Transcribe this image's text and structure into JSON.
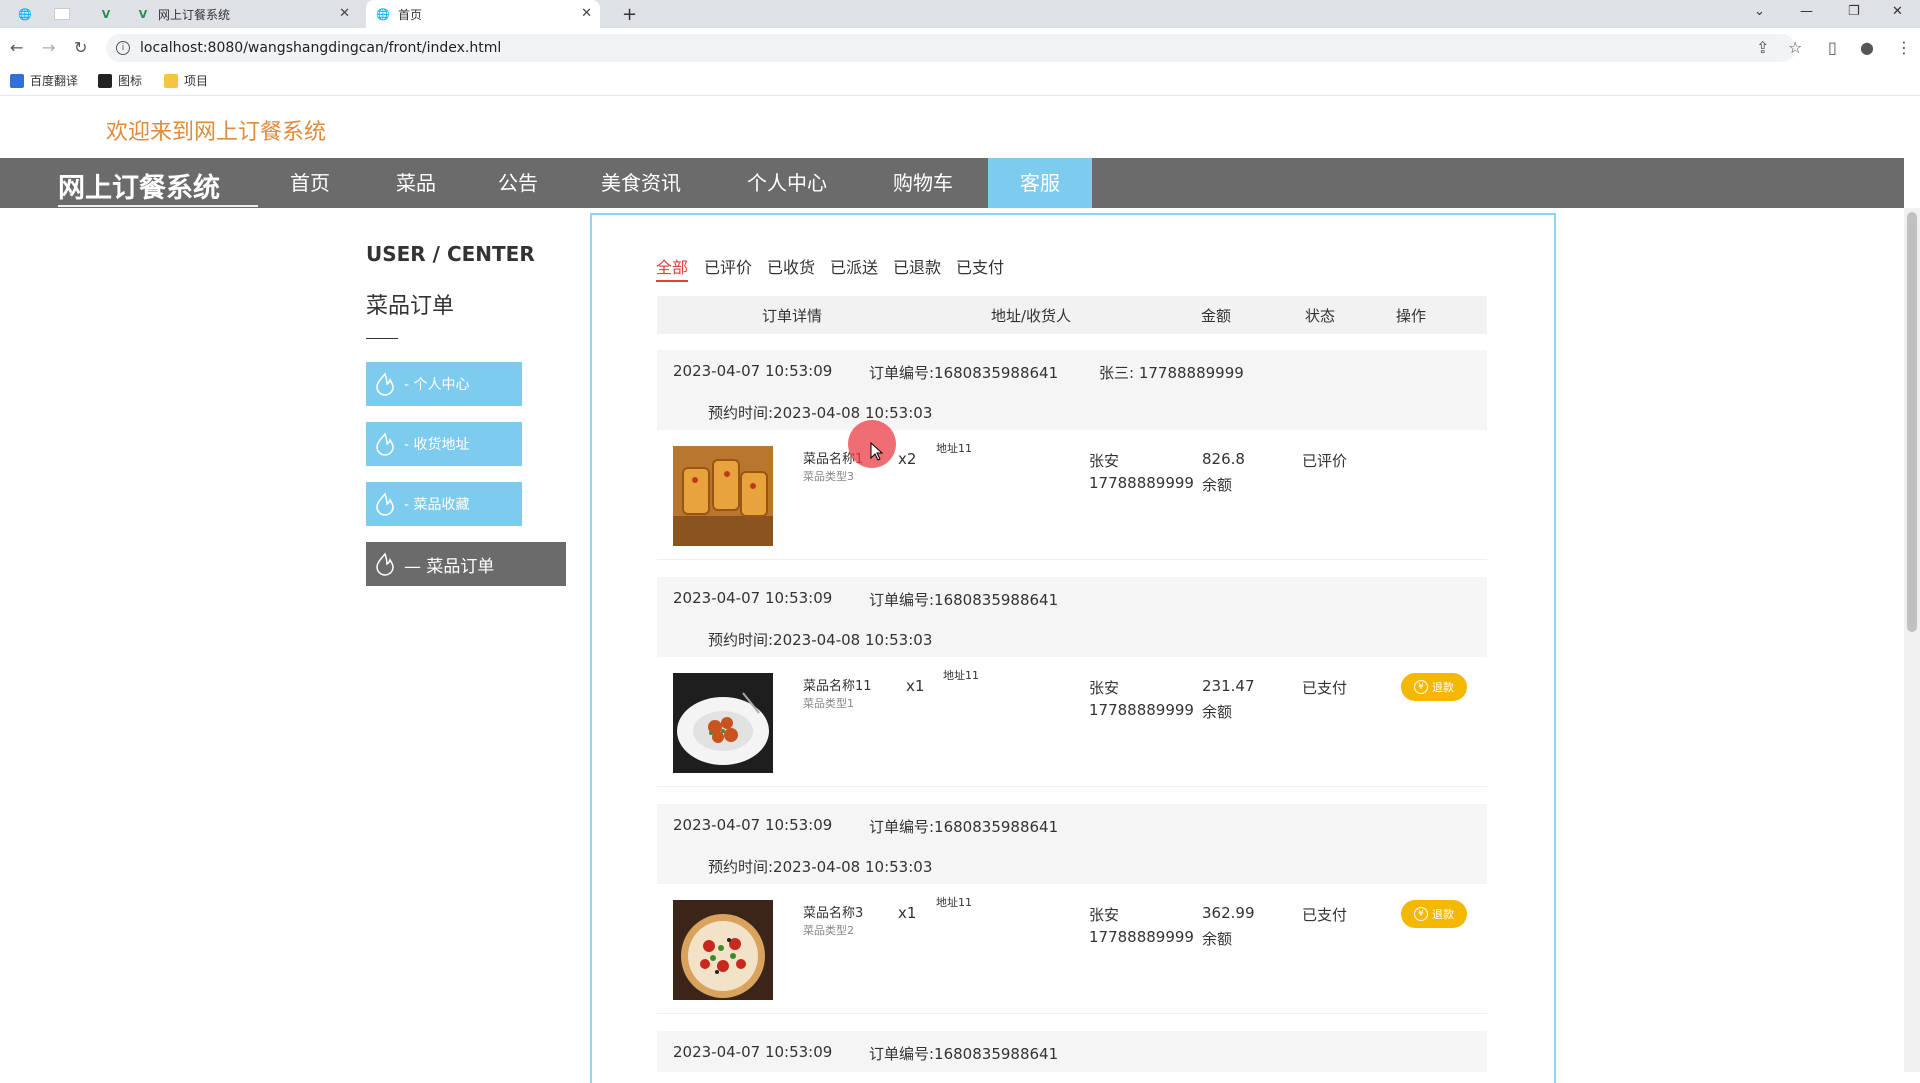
{
  "browser": {
    "tabs": [
      {
        "title": ""
      },
      {
        "title": "网上订餐系统"
      },
      {
        "title": "首页"
      }
    ],
    "url": "localhost:8080/wangshangdingcan/front/index.html",
    "bookmarks": [
      "百度翻译",
      "图标",
      "项目"
    ]
  },
  "header": {
    "welcome": "欢迎来到网上订餐系统",
    "brand": "网上订餐系统",
    "nav": [
      "首页",
      "菜品",
      "公告",
      "美食资讯",
      "个人中心",
      "购物车",
      "客服"
    ],
    "active_nav": "客服"
  },
  "sidebar": {
    "title": "USER / CENTER",
    "subtitle": "菜品订单",
    "items": [
      {
        "label": "- 个人中心"
      },
      {
        "label": "- 收货地址"
      },
      {
        "label": "- 菜品收藏"
      },
      {
        "label": "— 菜品订单"
      }
    ]
  },
  "filters": [
    "全部",
    "已评价",
    "已收货",
    "已派送",
    "已退款",
    "已支付"
  ],
  "table": {
    "columns": [
      "订单详情",
      "地址/收货人",
      "金额",
      "状态",
      "操作"
    ]
  },
  "orders": [
    {
      "time": "2023-04-07 10:53:09",
      "order_no": "订单编号:1680835988641",
      "contact": "张三:  17788889999",
      "reserve": "预约时间:2023-04-08 10:53:03",
      "item": "菜品名称1",
      "type": "菜品类型3",
      "qty": "x2",
      "addr": "地址11",
      "name": "张安",
      "phone": "17788889999",
      "amount": "826.8",
      "pay": "余额",
      "status": "已评价",
      "action": ""
    },
    {
      "time": "2023-04-07 10:53:09",
      "order_no": "订单编号:1680835988641",
      "contact": "",
      "reserve": "预约时间:2023-04-08 10:53:03",
      "item": "菜品名称11",
      "type": "菜品类型1",
      "qty": "x1",
      "addr": "地址11",
      "name": "张安",
      "phone": "17788889999",
      "amount": "231.47",
      "pay": "余额",
      "status": "已支付",
      "action": "退款"
    },
    {
      "time": "2023-04-07 10:53:09",
      "order_no": "订单编号:1680835988641",
      "contact": "",
      "reserve": "预约时间:2023-04-08 10:53:03",
      "item": "菜品名称3",
      "type": "菜品类型2",
      "qty": "x1",
      "addr": "地址11",
      "name": "张安",
      "phone": "17788889999",
      "amount": "362.99",
      "pay": "余额",
      "status": "已支付",
      "action": "退款"
    },
    {
      "time": "2023-04-07 10:53:09",
      "order_no": "订单编号:1680835988641"
    }
  ],
  "colors": {
    "accent": "#7ecbf0",
    "nav_bg": "#6b6b6b",
    "welcome": "#e08a3a",
    "refund": "#f5b800",
    "active_filter": "#e04040"
  }
}
